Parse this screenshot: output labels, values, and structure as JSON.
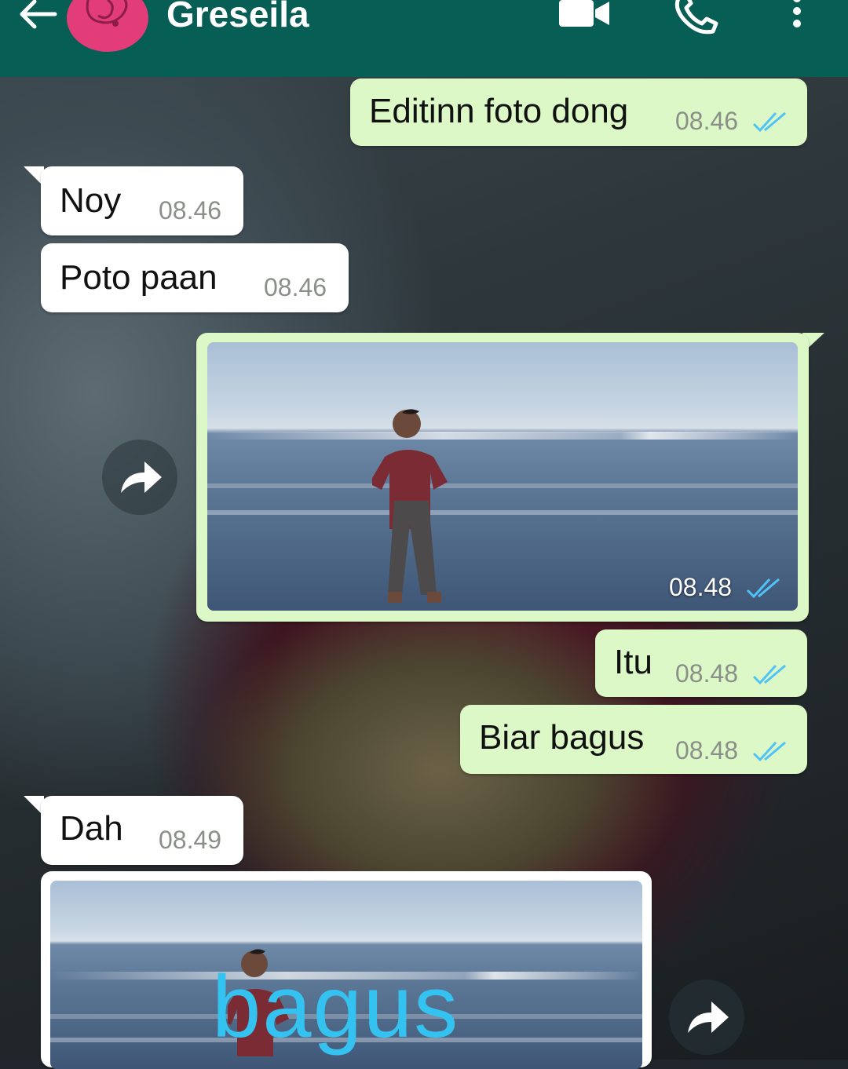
{
  "header": {
    "contact_name": "Greseila",
    "icons": [
      "back-arrow-icon",
      "avatar",
      "video-call-icon",
      "voice-call-icon",
      "more-options-icon"
    ]
  },
  "messages": [
    {
      "id": "m1",
      "direction": "outgoing",
      "text": "Editinn foto dong",
      "time": "08.46",
      "status": "read"
    },
    {
      "id": "m2",
      "direction": "incoming",
      "text": "Noy",
      "time": "08.46"
    },
    {
      "id": "m3",
      "direction": "incoming",
      "text": "Poto paan",
      "time": "08.46"
    },
    {
      "id": "m4",
      "direction": "outgoing",
      "type": "photo",
      "time": "08.48",
      "status": "read"
    },
    {
      "id": "m5",
      "direction": "outgoing",
      "text": "Itu",
      "time": "08.48",
      "status": "read"
    },
    {
      "id": "m6",
      "direction": "outgoing",
      "text": "Biar bagus",
      "time": "08.48",
      "status": "read"
    },
    {
      "id": "m7",
      "direction": "incoming",
      "text": "Dah",
      "time": "08.49"
    },
    {
      "id": "m8",
      "direction": "incoming",
      "type": "photo",
      "overlay_text": "bagus"
    }
  ],
  "colors": {
    "app_bar": "#075e54",
    "outgoing_bubble": "#dcf8c6",
    "incoming_bubble": "#ffffff",
    "read_ticks": "#4fc3f7",
    "overlay_text": "#34c3f0"
  }
}
